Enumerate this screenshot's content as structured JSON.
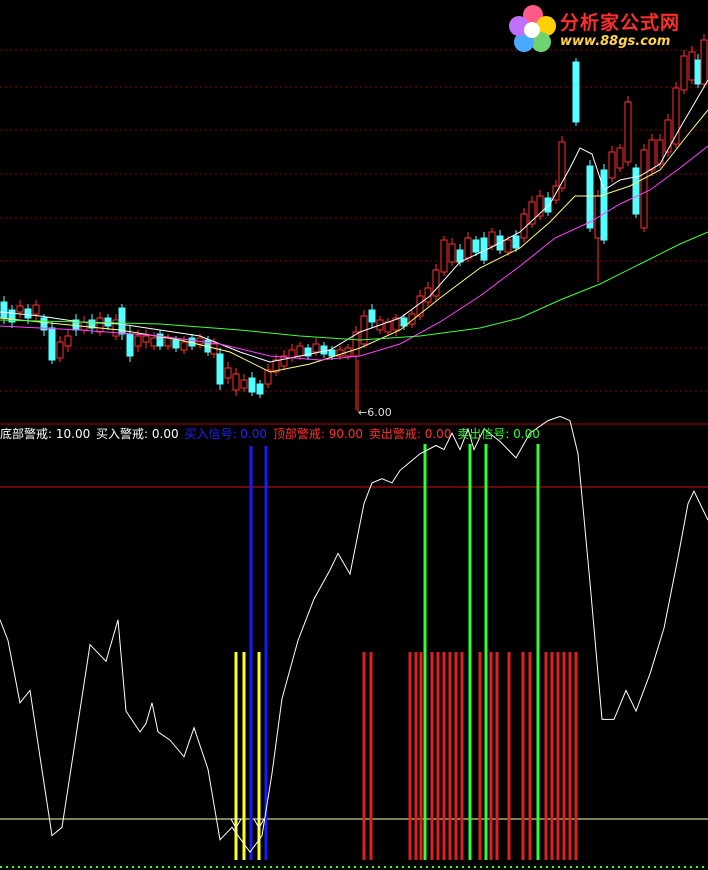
{
  "logo": {
    "name": "分析家公式网",
    "url": "www.88gs.com"
  },
  "price_panel": {
    "low_marker_label": "6.00",
    "colors": {
      "up_candle": "#ff3030",
      "down_candle": "#54ffff",
      "ma_short": "#ffffff",
      "ma_mid": "#ffff80",
      "ma_long": "#ff40ff",
      "ma_longest": "#40ff40",
      "grid": "#8a0000"
    }
  },
  "indicator_legend": [
    {
      "label": "底部警戒:",
      "value": "10.00",
      "color": "#ffffff"
    },
    {
      "label": "买入警戒:",
      "value": "0.00",
      "color": "#ffffff"
    },
    {
      "label": "买入信号:",
      "value": "0.00",
      "color": "#2020ff"
    },
    {
      "label": "顶部警戒:",
      "value": "90.00",
      "color": "#ff3030"
    },
    {
      "label": "卖出警戒:",
      "value": "0.00",
      "color": "#ff3030"
    },
    {
      "label": "卖出信号:",
      "value": "0.00",
      "color": "#30ff30"
    }
  ],
  "chart_data": {
    "type": "line",
    "levels": {
      "bottom_alert": 10,
      "top_alert": 90
    },
    "ylim": [
      0,
      100
    ],
    "oscillator": [
      [
        0,
        58
      ],
      [
        8,
        53
      ],
      [
        20,
        38
      ],
      [
        30,
        41
      ],
      [
        40,
        25
      ],
      [
        52,
        6
      ],
      [
        62,
        8
      ],
      [
        76,
        30
      ],
      [
        90,
        52
      ],
      [
        106,
        48
      ],
      [
        118,
        58
      ],
      [
        126,
        36
      ],
      [
        140,
        31
      ],
      [
        146,
        33
      ],
      [
        152,
        38
      ],
      [
        158,
        31
      ],
      [
        170,
        29
      ],
      [
        184,
        25
      ],
      [
        194,
        32
      ],
      [
        208,
        22
      ],
      [
        220,
        5
      ],
      [
        232,
        8
      ],
      [
        250,
        2
      ],
      [
        262,
        6
      ],
      [
        272,
        21
      ],
      [
        282,
        39
      ],
      [
        298,
        53
      ],
      [
        314,
        63
      ],
      [
        330,
        70
      ],
      [
        338,
        74
      ],
      [
        350,
        69
      ],
      [
        364,
        86
      ],
      [
        372,
        91
      ],
      [
        382,
        92
      ],
      [
        392,
        91
      ],
      [
        400,
        94
      ],
      [
        410,
        96
      ],
      [
        420,
        98
      ],
      [
        436,
        100
      ],
      [
        444,
        99
      ],
      [
        452,
        103
      ],
      [
        460,
        99
      ],
      [
        468,
        104
      ],
      [
        474,
        99
      ],
      [
        484,
        104
      ],
      [
        500,
        101
      ],
      [
        516,
        97
      ],
      [
        530,
        103
      ],
      [
        548,
        106
      ],
      [
        560,
        107
      ],
      [
        570,
        106
      ],
      [
        578,
        98
      ],
      [
        590,
        67
      ],
      [
        602,
        34
      ],
      [
        614,
        34
      ],
      [
        626,
        41
      ],
      [
        636,
        36
      ],
      [
        650,
        45
      ],
      [
        664,
        56
      ],
      [
        678,
        73
      ],
      [
        688,
        86
      ],
      [
        694,
        89
      ],
      [
        708,
        82
      ]
    ],
    "buy_alert_bars_x": [
      236,
      244,
      259
    ],
    "buy_signal_bars_x": [
      251,
      266
    ],
    "sell_alert_bars_x": [
      364,
      371,
      410,
      416,
      421,
      432,
      438,
      444,
      450,
      456,
      462,
      480,
      491,
      497,
      509,
      523,
      530,
      546,
      552,
      558,
      564,
      570,
      576
    ],
    "sell_signal_bars_x": [
      425,
      470,
      486,
      538
    ]
  }
}
